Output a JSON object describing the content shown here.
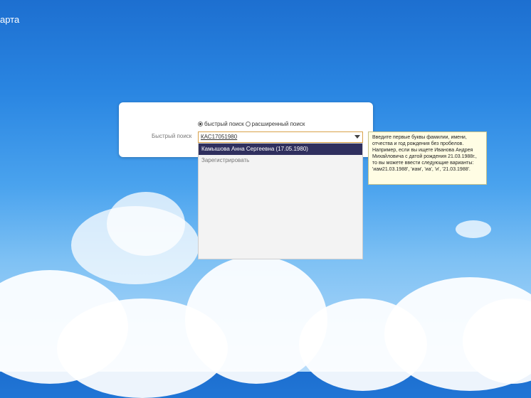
{
  "page": {
    "title_partial": "арта"
  },
  "search_mode": {
    "options": [
      {
        "label": "быстрый поиск",
        "checked": true
      },
      {
        "label": "расширенный поиск",
        "checked": false
      }
    ]
  },
  "quick_search": {
    "label": "Быстрый поиск",
    "value": "КАС17051980"
  },
  "dropdown": {
    "items": [
      {
        "label": "Камышова Анна Сергеевна (17.05.1980)",
        "selected": true
      },
      {
        "label": "Зарегистрировать",
        "selected": false
      }
    ]
  },
  "tooltip": {
    "text": "Введите первые буквы фамилии, имени, отчества и год рождения без пробелов. Например, если вы ищете Иванова Андрея Михайловича с датой рождения 21.03.1988г., то вы можете ввести следующие варианты: 'иам21.03.1988', 'иам', 'иа', 'и', '21.03.1988'."
  },
  "colors": {
    "selected_bg": "#2f2f5e",
    "input_border": "#d9a24a",
    "tooltip_bg": "#fffde4"
  }
}
